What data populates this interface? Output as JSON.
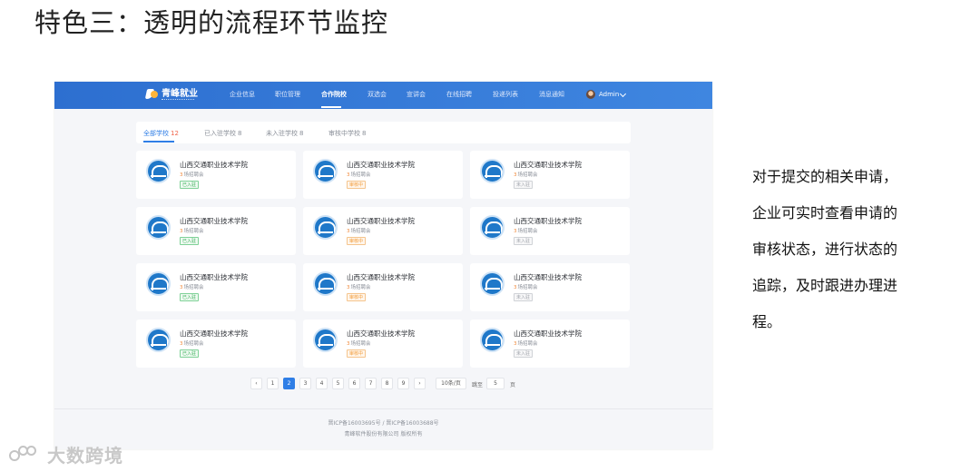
{
  "slide": {
    "title": "特色三：透明的流程环节监控",
    "description": [
      "对于提交的相关申请，",
      "企业可实时查看申请的",
      "审核状态，进行状态的",
      "追踪，及时跟进办理进",
      "程。"
    ],
    "watermark": "大数跨境"
  },
  "app": {
    "brand": "青峰就业",
    "nav": [
      "企业信息",
      "职位管理",
      "合作院校",
      "双选会",
      "宣讲会",
      "在线招聘",
      "投递列表",
      "消息通知"
    ],
    "active_nav": "合作院校",
    "user": "Admin",
    "accent_color": "#2f7ee6"
  },
  "tabs": [
    {
      "label": "全部学校",
      "count": "12",
      "active": true
    },
    {
      "label": "已入驻学校",
      "count": "8",
      "active": false
    },
    {
      "label": "未入驻学校",
      "count": "8",
      "active": false
    },
    {
      "label": "审核中学校",
      "count": "8",
      "active": false
    }
  ],
  "schools": [
    {
      "name": "山西交通职业技术学院",
      "fairs": "3",
      "fairs_label": "场招聘会",
      "status": "已入驻",
      "tone": "green"
    },
    {
      "name": "山西交通职业技术学院",
      "fairs": "3",
      "fairs_label": "场招聘会",
      "status": "审核中",
      "tone": "orange"
    },
    {
      "name": "山西交通职业技术学院",
      "fairs": "3",
      "fairs_label": "场招聘会",
      "status": "未入驻",
      "tone": "gray"
    },
    {
      "name": "山西交通职业技术学院",
      "fairs": "3",
      "fairs_label": "场招聘会",
      "status": "已入驻",
      "tone": "green"
    },
    {
      "name": "山西交通职业技术学院",
      "fairs": "3",
      "fairs_label": "场招聘会",
      "status": "审核中",
      "tone": "orange"
    },
    {
      "name": "山西交通职业技术学院",
      "fairs": "3",
      "fairs_label": "场招聘会",
      "status": "未入驻",
      "tone": "gray"
    },
    {
      "name": "山西交通职业技术学院",
      "fairs": "3",
      "fairs_label": "场招聘会",
      "status": "已入驻",
      "tone": "green"
    },
    {
      "name": "山西交通职业技术学院",
      "fairs": "3",
      "fairs_label": "场招聘会",
      "status": "审核中",
      "tone": "orange"
    },
    {
      "name": "山西交通职业技术学院",
      "fairs": "3",
      "fairs_label": "场招聘会",
      "status": "未入驻",
      "tone": "gray"
    },
    {
      "name": "山西交通职业技术学院",
      "fairs": "3",
      "fairs_label": "场招聘会",
      "status": "已入驻",
      "tone": "green"
    },
    {
      "name": "山西交通职业技术学院",
      "fairs": "3",
      "fairs_label": "场招聘会",
      "status": "审核中",
      "tone": "orange"
    },
    {
      "name": "山西交通职业技术学院",
      "fairs": "3",
      "fairs_label": "场招聘会",
      "status": "未入驻",
      "tone": "gray"
    }
  ],
  "pagination": {
    "prev": "‹",
    "next": "›",
    "pages": [
      "1",
      "2",
      "3",
      "4",
      "5",
      "6",
      "7",
      "8",
      "9"
    ],
    "current": "2",
    "page_size": "10条/页",
    "jump_label": "跳至",
    "jump_value": "5",
    "page_suffix": "页"
  },
  "footer": {
    "icp": "晋ICP备16003695号 / 晋ICP备16003688号",
    "copyright": "青峰软件股份有限公司 版权所有"
  }
}
